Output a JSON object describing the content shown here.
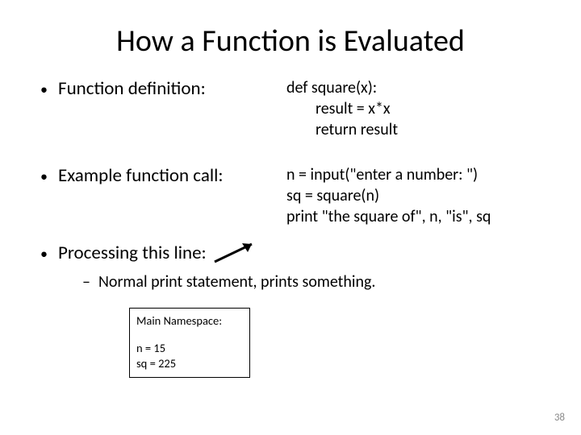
{
  "title": "How a Function is Evaluated",
  "bullets": {
    "def": "Function definition:",
    "ex": "Example function call:",
    "proc": "Processing this line:"
  },
  "code_def": {
    "l1": "def square(x):",
    "l2": "result = x*x",
    "l3": "return result"
  },
  "code_ex": {
    "l1": "n = input(\"enter a number: \")",
    "l2": "sq = square(n)",
    "l3": "print \"the square of\", n, \"is\", sq"
  },
  "sub": "Normal print statement, prints something.",
  "ns": {
    "title": "Main Namespace:",
    "l1": "n = 15",
    "l2": "sq = 225"
  },
  "page": "38"
}
